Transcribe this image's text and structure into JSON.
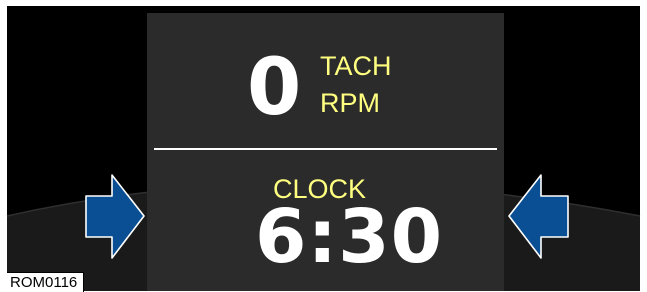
{
  "display": {
    "tachometer": {
      "value": "0",
      "label_line1": "TACH",
      "label_line2": "RPM"
    },
    "clock": {
      "label": "CLOCK",
      "time": "6:30"
    }
  },
  "figure_code": "ROM0116",
  "colors": {
    "screen_background": "#2b2b2b",
    "label_text": "#ffff80",
    "value_text": "#ffffff",
    "arrow_fill": "#0a4f93",
    "cluster_background": "#000000"
  },
  "icons": [
    "left-blue-arrow-icon",
    "right-blue-arrow-icon",
    "left-pointer-icon",
    "right-pointer-icon"
  ]
}
